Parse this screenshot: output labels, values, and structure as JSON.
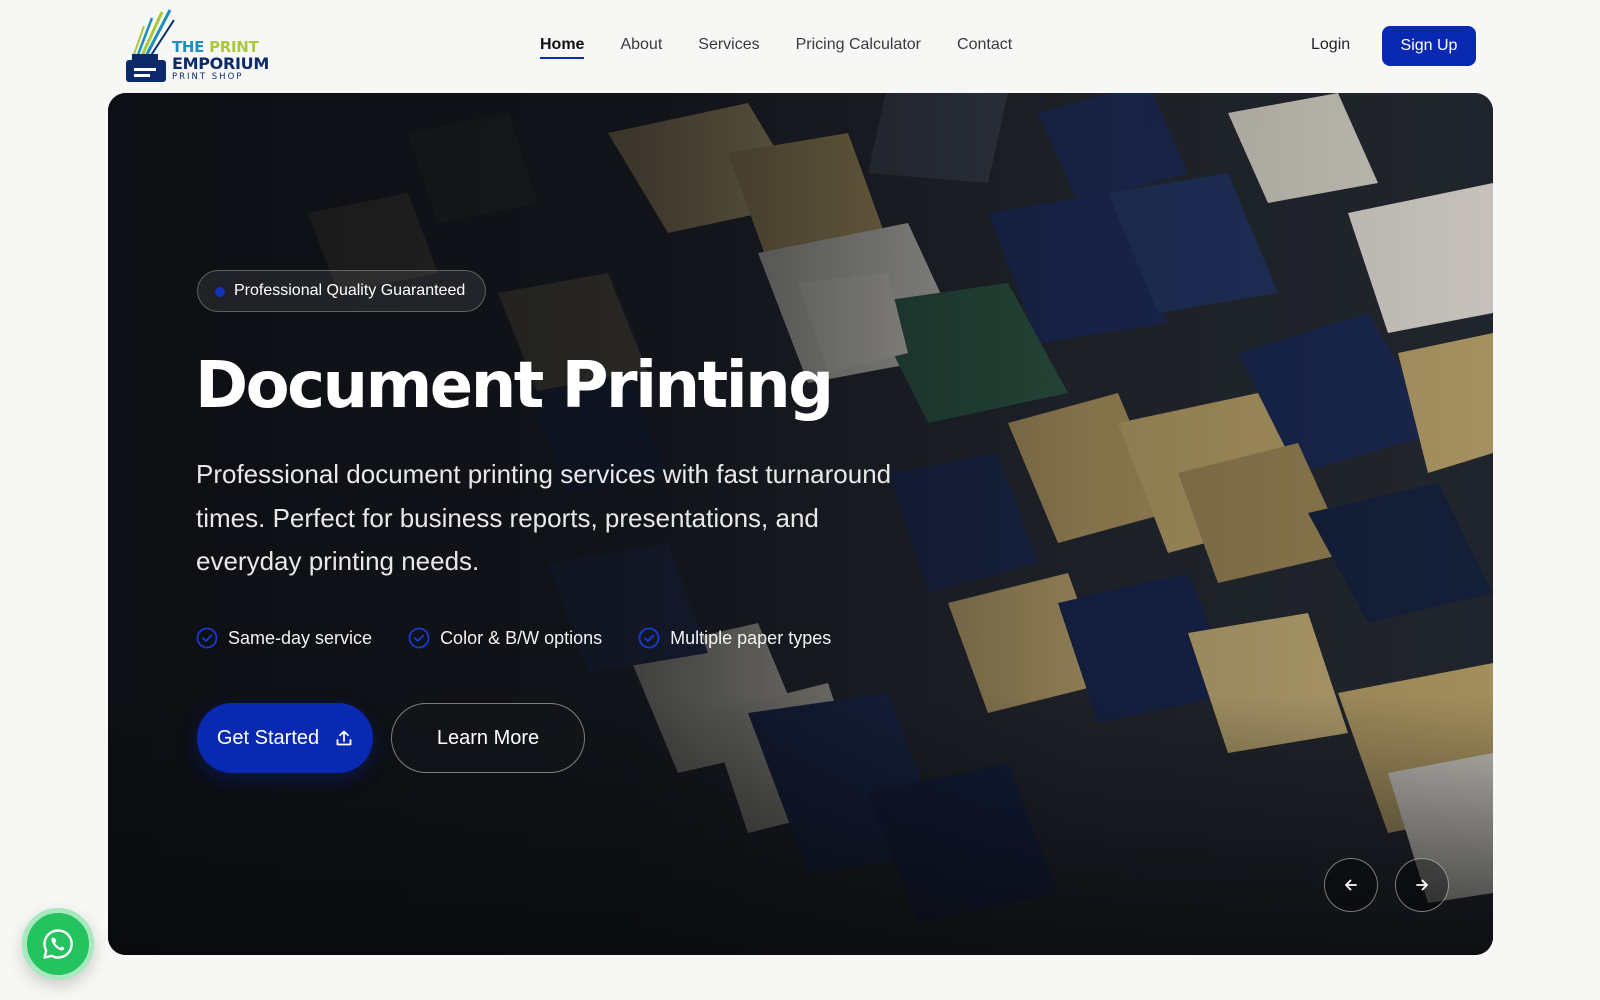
{
  "brand": {
    "line1_a": "THE",
    "line1_b": "PRINT",
    "line2": "EMPORIUM",
    "line3": "PRINT SHOP",
    "colors": {
      "primary": "#0a29b3",
      "navy": "#0c2a6a",
      "teal": "#1e8fb8",
      "lime": "#a9c93a"
    }
  },
  "nav": {
    "items": [
      {
        "label": "Home",
        "active": true
      },
      {
        "label": "About"
      },
      {
        "label": "Services"
      },
      {
        "label": "Pricing Calculator"
      },
      {
        "label": "Contact"
      }
    ],
    "login_label": "Login",
    "signup_label": "Sign Up"
  },
  "hero": {
    "badge": "Professional Quality Guaranteed",
    "title": "Document Printing",
    "description": "Professional document printing services with fast turnaround times. Perfect for business reports, presentations, and everyday printing needs.",
    "features": [
      {
        "label": "Same-day service",
        "icon": "check-circle-icon"
      },
      {
        "label": "Color & B/W options",
        "icon": "check-circle-icon"
      },
      {
        "label": "Multiple paper types",
        "icon": "check-circle-icon"
      }
    ],
    "primary_cta": {
      "label": "Get Started",
      "icon": "upload-icon"
    },
    "secondary_cta": {
      "label": "Learn More"
    },
    "carousel": {
      "prev_icon": "arrow-left-icon",
      "next_icon": "arrow-right-icon"
    }
  },
  "floating": {
    "whatsapp_icon": "whatsapp-icon",
    "color": "#25c35f"
  }
}
